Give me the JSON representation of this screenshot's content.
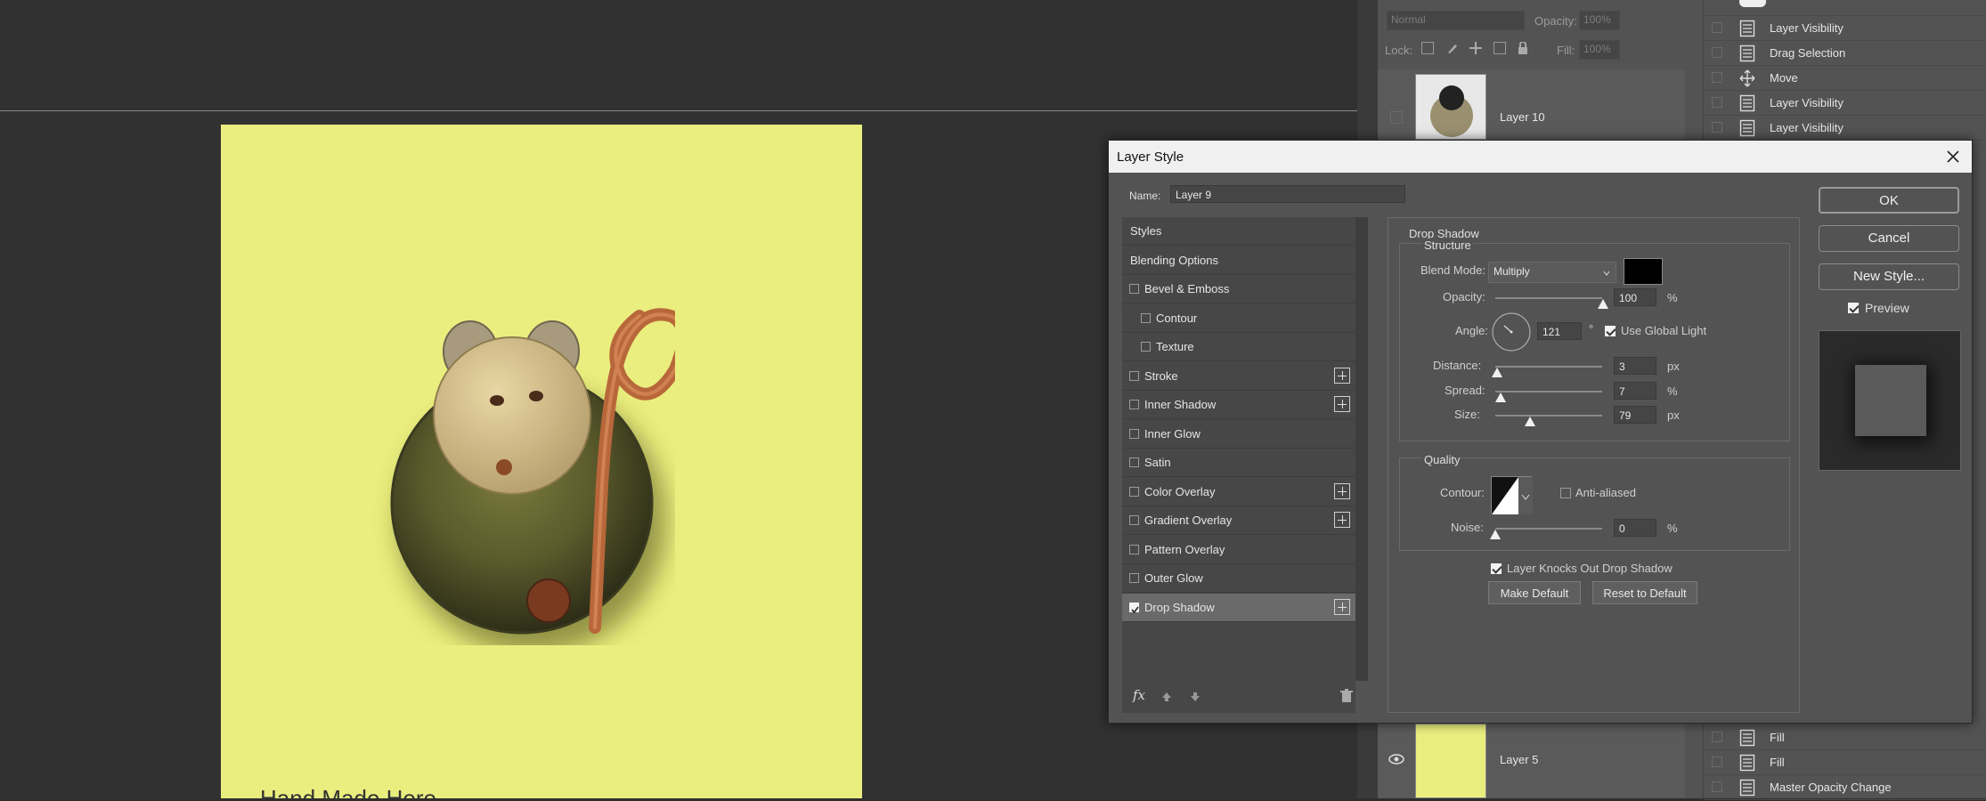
{
  "canvas": {
    "caption": "Hand Made Here",
    "background_color": "#eaee7e"
  },
  "layers_panel": {
    "blend_mode": "Normal",
    "opacity_label": "Opacity:",
    "opacity_value": "100%",
    "lock_label": "Lock:",
    "fill_label": "Fill:",
    "fill_value": "100%",
    "layers": [
      {
        "name": "Layer 10",
        "visible": false
      },
      {
        "name": "Layer 5",
        "visible": true
      }
    ]
  },
  "history_panel": {
    "items": [
      {
        "label": "Layer Visibility",
        "icon": "document-icon"
      },
      {
        "label": "Drag Selection",
        "icon": "document-icon"
      },
      {
        "label": "Move",
        "icon": "move-icon"
      },
      {
        "label": "Layer Visibility",
        "icon": "document-icon"
      },
      {
        "label": "Layer Visibility",
        "icon": "document-icon"
      }
    ],
    "bottom_items": [
      {
        "label": "Fill",
        "icon": "document-icon"
      },
      {
        "label": "Fill",
        "icon": "document-icon"
      },
      {
        "label": "Master Opacity Change",
        "icon": "document-icon"
      }
    ]
  },
  "dialog": {
    "title": "Layer Style",
    "name_label": "Name:",
    "name_value": "Layer 9",
    "styles": [
      {
        "label": "Styles",
        "checkbox": false,
        "checked": false,
        "indent": false,
        "plus": false,
        "selected": false
      },
      {
        "label": "Blending Options",
        "checkbox": false,
        "checked": false,
        "indent": false,
        "plus": false,
        "selected": false
      },
      {
        "label": "Bevel & Emboss",
        "checkbox": true,
        "checked": false,
        "indent": false,
        "plus": false,
        "selected": false
      },
      {
        "label": "Contour",
        "checkbox": true,
        "checked": false,
        "indent": true,
        "plus": false,
        "selected": false
      },
      {
        "label": "Texture",
        "checkbox": true,
        "checked": false,
        "indent": true,
        "plus": false,
        "selected": false
      },
      {
        "label": "Stroke",
        "checkbox": true,
        "checked": false,
        "indent": false,
        "plus": true,
        "selected": false
      },
      {
        "label": "Inner Shadow",
        "checkbox": true,
        "checked": false,
        "indent": false,
        "plus": true,
        "selected": false
      },
      {
        "label": "Inner Glow",
        "checkbox": true,
        "checked": false,
        "indent": false,
        "plus": false,
        "selected": false
      },
      {
        "label": "Satin",
        "checkbox": true,
        "checked": false,
        "indent": false,
        "plus": false,
        "selected": false
      },
      {
        "label": "Color Overlay",
        "checkbox": true,
        "checked": false,
        "indent": false,
        "plus": true,
        "selected": false
      },
      {
        "label": "Gradient Overlay",
        "checkbox": true,
        "checked": false,
        "indent": false,
        "plus": true,
        "selected": false
      },
      {
        "label": "Pattern Overlay",
        "checkbox": true,
        "checked": false,
        "indent": false,
        "plus": false,
        "selected": false
      },
      {
        "label": "Outer Glow",
        "checkbox": true,
        "checked": false,
        "indent": false,
        "plus": false,
        "selected": false
      },
      {
        "label": "Drop Shadow",
        "checkbox": true,
        "checked": true,
        "indent": false,
        "plus": true,
        "selected": true
      }
    ],
    "drop_shadow": {
      "section_title": "Drop Shadow",
      "structure_title": "Structure",
      "blend_mode_label": "Blend Mode:",
      "blend_mode_value": "Multiply",
      "shadow_color": "#000000",
      "opacity_label": "Opacity:",
      "opacity_value": "100",
      "opacity_unit": "%",
      "angle_label": "Angle:",
      "angle_value": "121",
      "angle_unit": "°",
      "use_global_light_label": "Use Global Light",
      "use_global_light": true,
      "distance_label": "Distance:",
      "distance_value": "3",
      "distance_unit": "px",
      "spread_label": "Spread:",
      "spread_value": "7",
      "spread_unit": "%",
      "size_label": "Size:",
      "size_value": "79",
      "size_unit": "px",
      "quality_title": "Quality",
      "contour_label": "Contour:",
      "anti_aliased_label": "Anti-aliased",
      "anti_aliased": false,
      "noise_label": "Noise:",
      "noise_value": "0",
      "noise_unit": "%",
      "knocks_out_label": "Layer Knocks Out Drop Shadow",
      "knocks_out": true,
      "make_default_label": "Make Default",
      "reset_default_label": "Reset to Default"
    },
    "buttons": {
      "ok": "OK",
      "cancel": "Cancel",
      "new_style": "New Style...",
      "preview_label": "Preview",
      "preview_checked": true
    },
    "footer_icons": [
      "fx-icon",
      "move-up-icon",
      "move-down-icon",
      "trash-icon"
    ]
  }
}
